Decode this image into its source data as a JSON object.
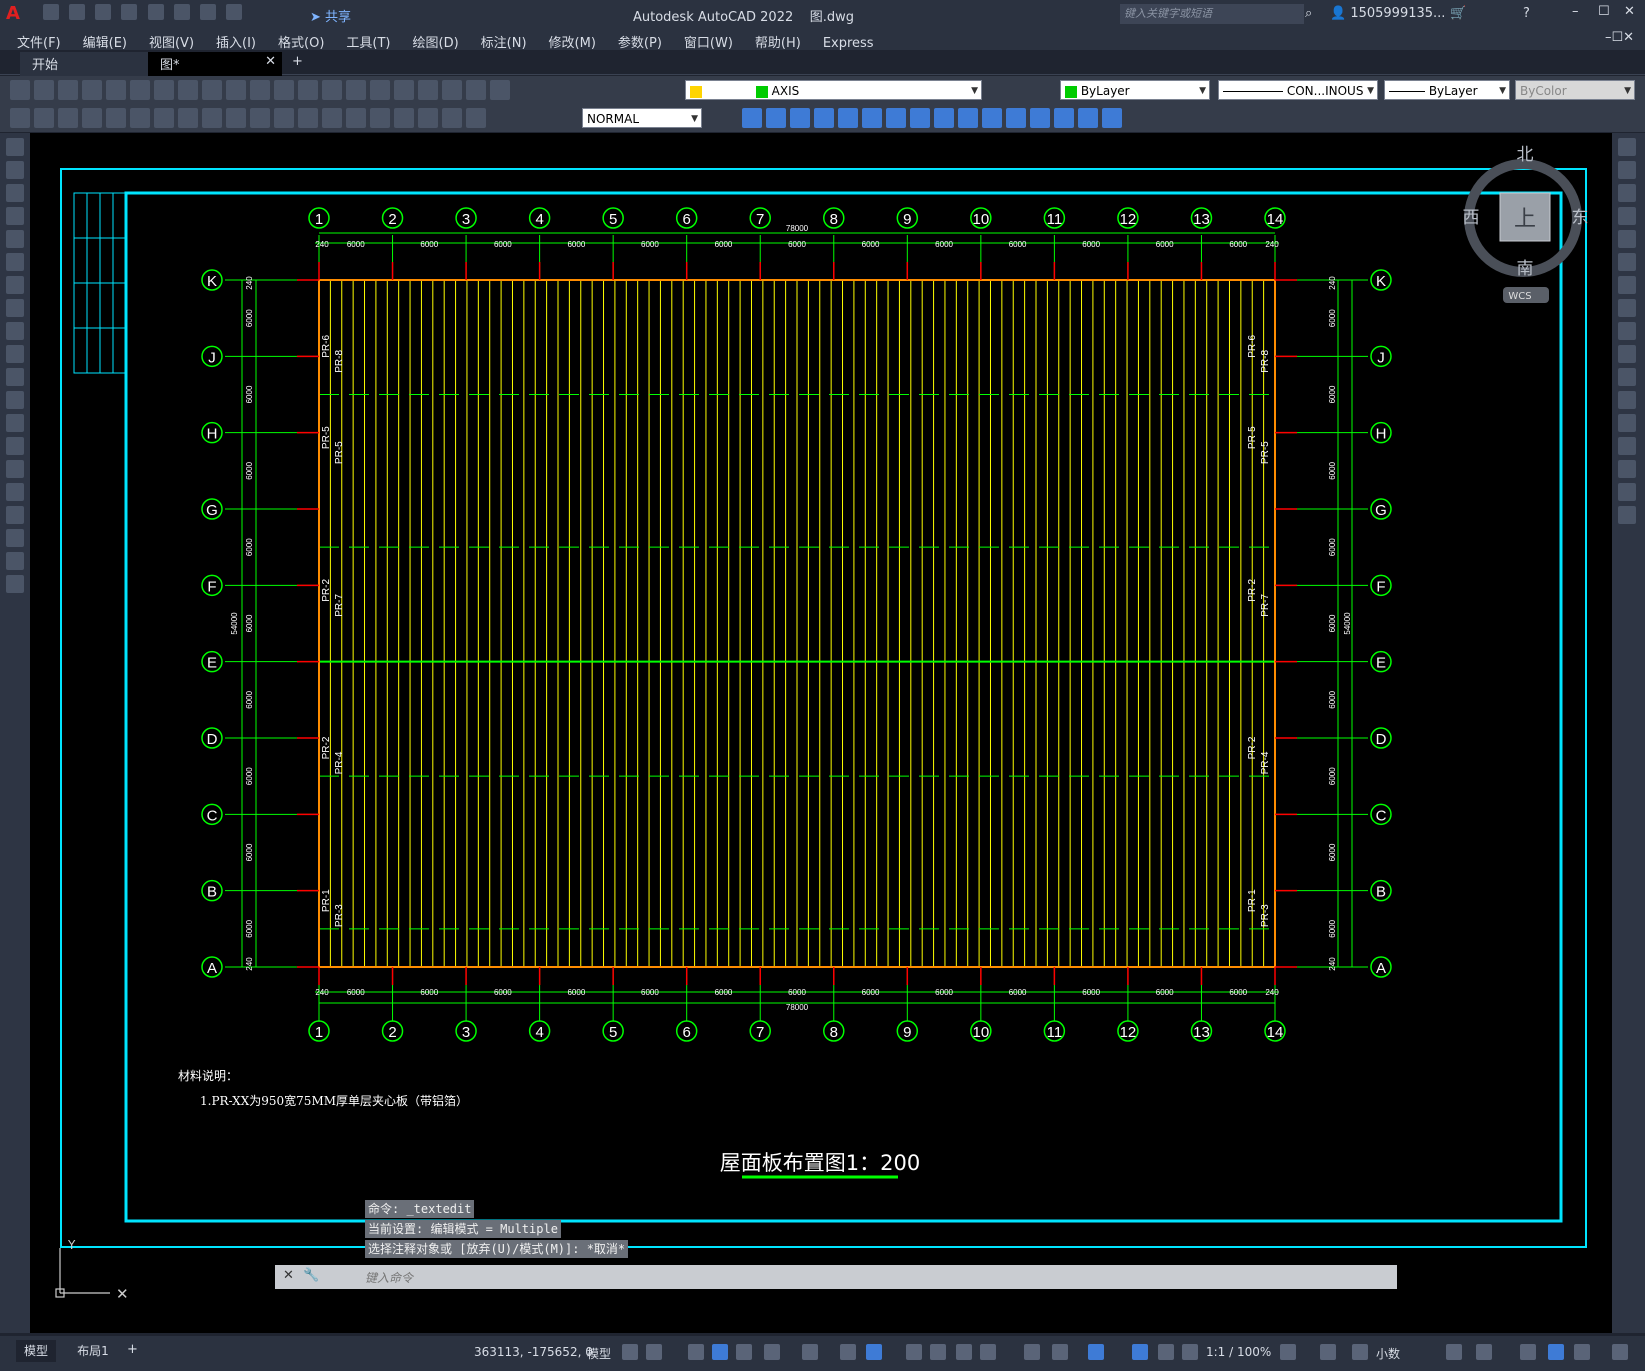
{
  "titlebar": {
    "title": "Autodesk AutoCAD 2022",
    "filename": "图.dwg",
    "search_placeholder": "键入关键字或短语",
    "user": "1505999135...",
    "share": "共享"
  },
  "menu": [
    "文件(F)",
    "编辑(E)",
    "视图(V)",
    "插入(I)",
    "格式(O)",
    "工具(T)",
    "绘图(D)",
    "标注(N)",
    "修改(M)",
    "参数(P)",
    "窗口(W)",
    "帮助(H)",
    "Express"
  ],
  "tabs": {
    "start": "开始",
    "doc": "图*",
    "add": "+"
  },
  "toolbar": {
    "layer": "AXIS",
    "color": "ByLayer",
    "linetype": "CON...INOUS",
    "lineweight": "ByLayer",
    "plotstyle": "ByColor",
    "textstyle": "NORMAL"
  },
  "colors": {
    "canvas": "#000000",
    "frame": "#00e5ff",
    "grid": "#00ff00",
    "panel": "#ffff00",
    "accent_red": "#ff0000"
  },
  "viewcube": {
    "north": "北",
    "south": "南",
    "east": "东",
    "west": "西",
    "top": "上",
    "wcs": "WCS"
  },
  "drawing": {
    "cols": [
      "1",
      "2",
      "3",
      "4",
      "5",
      "6",
      "7",
      "8",
      "9",
      "10",
      "11",
      "12",
      "13",
      "14"
    ],
    "rows": [
      "K",
      "J",
      "H",
      "G",
      "F",
      "E",
      "D",
      "C",
      "B",
      "A"
    ],
    "total_width": "78000",
    "bay": "6000",
    "edge": "240",
    "total_depth": "54000",
    "left_labels_a": [
      "PR-6",
      "PR-5",
      "PR-2",
      "PR-2",
      "PR-1"
    ],
    "left_labels_b": [
      "PR-8",
      "PR-5",
      "PR-7",
      "PR-4",
      "PR-3"
    ],
    "note_title": "材料说明：",
    "note_line": "1.PR-XX为950宽75MM厚单层夹心板（带铝箔）",
    "drawing_title": "屋面板布置图1：200"
  },
  "command": {
    "line1": "命令: _textedit",
    "line2": "当前设置: 编辑模式 = Multiple",
    "line3": "选择注释对象或 [放弃(U)/模式(M)]: *取消*",
    "placeholder": "键入命令"
  },
  "status": {
    "tab_model": "模型",
    "tab_layout": "布局1",
    "coords": "363113, -175652, 0",
    "mode": "模型",
    "scale": "1:1 / 100%",
    "units": "小数"
  }
}
